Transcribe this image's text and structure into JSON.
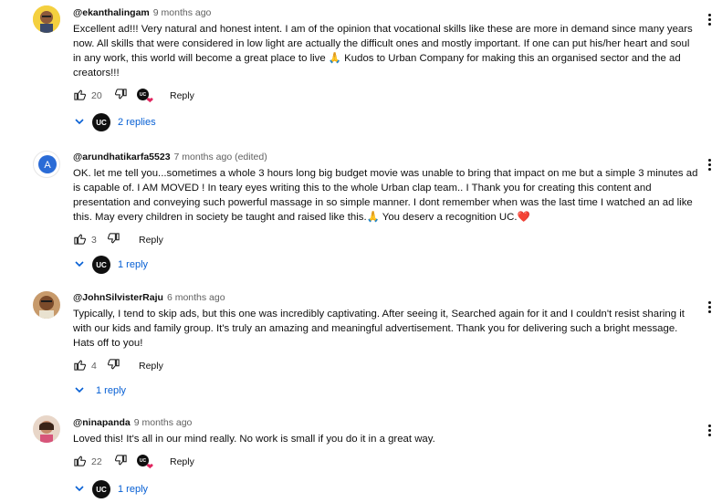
{
  "comments": [
    {
      "handle": "@ekanthalingam",
      "time": "9 months ago",
      "text": "Excellent ad!!! Very natural and honest intent. I am of the opinion that vocational skills like these are more in demand since many years now. All skills that were considered in low light are actually the difficult ones and mostly important. If one can put his/her heart and soul in any work, this world will become a great place to live 🙏 Kudos to Urban Company for making this an organised sector and the ad creators!!!",
      "likes": "20",
      "reply_label": "Reply",
      "replies_label": "2 replies",
      "creator_badge": "UC",
      "heart_badge": "UC"
    },
    {
      "handle": "@arundhatikarfa5523",
      "time": "7 months ago (edited)",
      "text": "OK. let me tell you...sometimes a whole 3 hours long big budget movie was unable to bring that impact on me  but  a simple 3 minutes ad is capable of. I AM MOVED ! In teary eyes writing  this to the whole Urban clap team..  I Thank you for creating this  content and presentation and conveying such  powerful  massage in so simple manner. I dont remember when was the last time I watched  an ad like this. May every children in society be taught and raised like this.🙏 You deserv a recognition UC.❤️",
      "likes": "3",
      "reply_label": "Reply",
      "replies_label": "1 reply",
      "creator_badge": "UC"
    },
    {
      "handle": "@JohnSilvisterRaju",
      "time": "6 months ago",
      "text": "Typically, I tend to skip ads, but this one was incredibly captivating. After seeing it, Searched again for it and I couldn't resist sharing it with our kids and family group. It's truly an amazing and meaningful advertisement. Thank you for delivering such a bright message. Hats off to you!",
      "likes": "4",
      "reply_label": "Reply",
      "replies_label": "1 reply"
    },
    {
      "handle": "@ninapanda",
      "time": "9 months ago",
      "text": "Loved this! It's all in our mind really. No work is small if you do it in a great way.",
      "likes": "22",
      "reply_label": "Reply",
      "replies_label": "1 reply",
      "creator_badge": "UC",
      "heart_badge": "UC"
    }
  ],
  "colors": {
    "link": "#065fd4",
    "heart": "#e0245e",
    "muted": "#606060"
  },
  "icons": [
    "thumb-up-icon",
    "thumb-down-icon",
    "chevron-down-icon",
    "more-vert-icon",
    "heart-icon"
  ]
}
